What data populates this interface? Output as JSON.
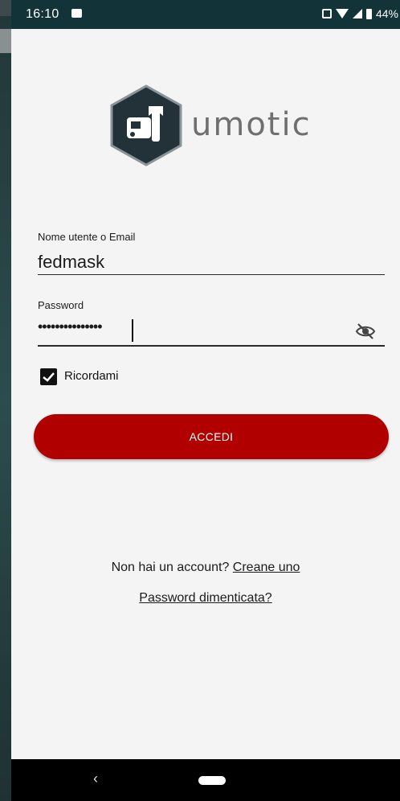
{
  "status_bar": {
    "time": "16:10",
    "battery": "44%",
    "icons": [
      "image-icon",
      "vibrate-icon",
      "wifi-icon",
      "signal-icon",
      "battery-icon"
    ]
  },
  "logo": {
    "text": "umotic",
    "icon": "car-wrench-icon",
    "hex_color": "#233238",
    "text_color": "#6f6f6f"
  },
  "form": {
    "username_label": "Nome utente o Email",
    "username_value": "fedmask",
    "password_label": "Password",
    "password_value": "•••••••••••••••",
    "password_toggle_icon": "eye-off-icon",
    "remember_label": "Ricordami",
    "remember_checked": true,
    "login_label": "ACCEDI",
    "accent_color": "#b00000"
  },
  "footer": {
    "signup_prompt": "Non hai un account?",
    "signup_link": "Creane uno",
    "forgot_link": "Password dimenticata?"
  },
  "nav_bar": {
    "back_symbol": "‹",
    "icons": [
      "back-icon",
      "home-pill-icon"
    ]
  }
}
